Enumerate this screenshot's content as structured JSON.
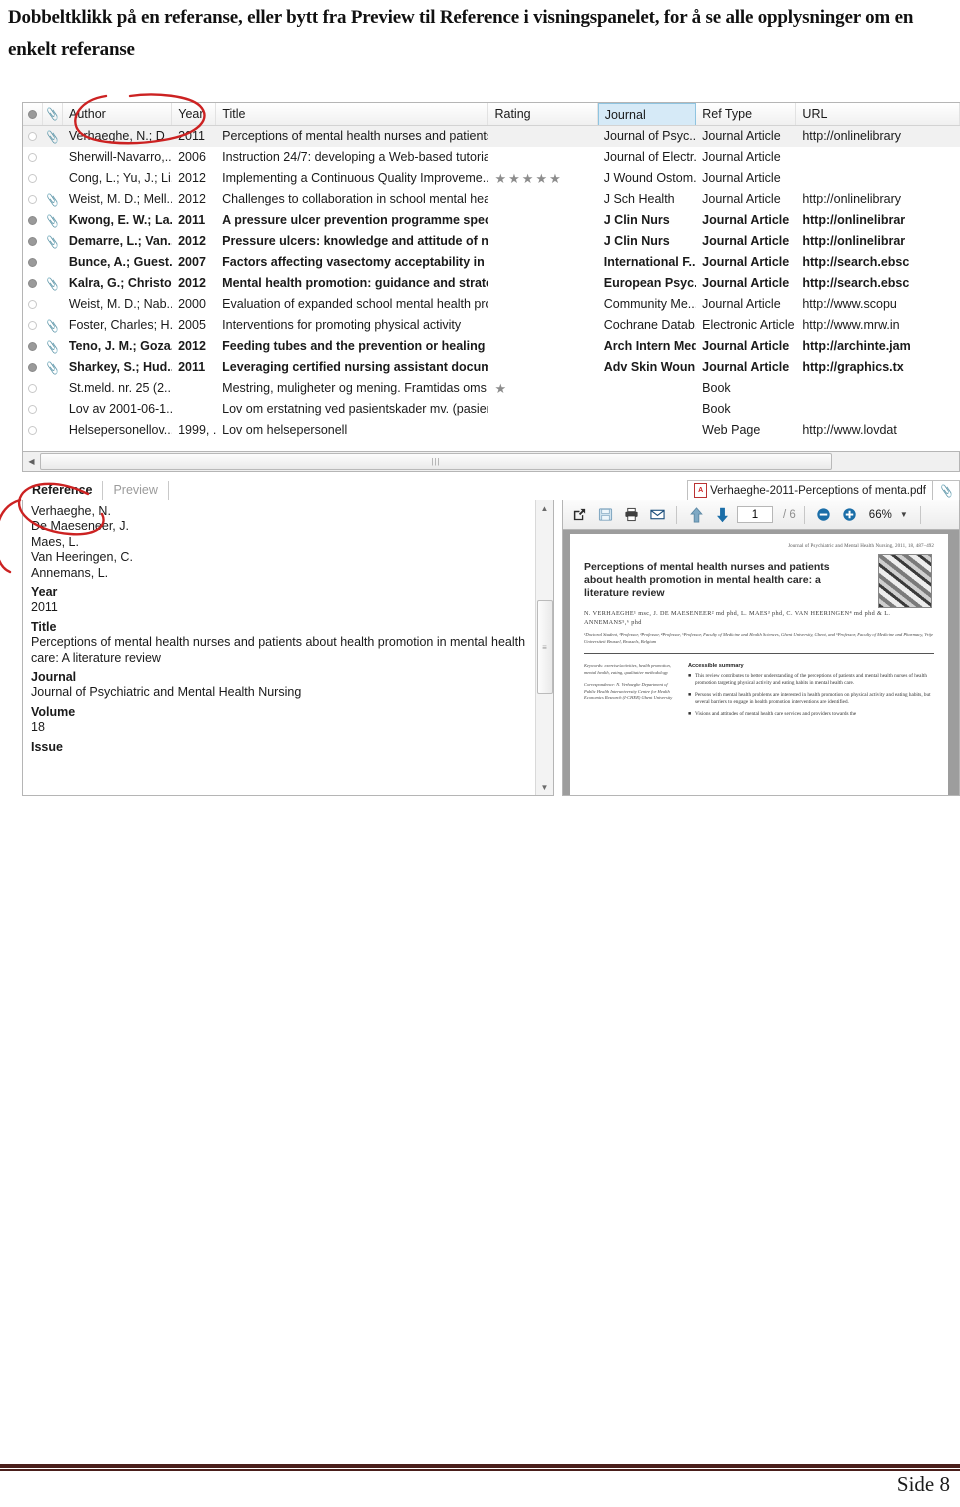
{
  "heading": "Dobbeltklikk på en referanse, eller bytt fra Preview til Reference i visningspanelet, for å se alle opplysninger om en enkelt referanse",
  "list": {
    "columns": [
      "Author",
      "Year",
      "Title",
      "Rating",
      "Journal",
      "Ref Type",
      "URL"
    ],
    "highlighted_column": "Journal",
    "rows": [
      {
        "read": false,
        "clip": true,
        "bold": false,
        "selected": true,
        "author": "Verhaeghe, N.; D...",
        "year": "2011",
        "title": "Perceptions of mental health nurses and patients...",
        "rating": 0,
        "journal": "Journal of Psyc...",
        "reftype": "Journal Article",
        "url": "http://onlinelibrary"
      },
      {
        "read": false,
        "clip": false,
        "bold": false,
        "selected": false,
        "author": "Sherwill-Navarro,...",
        "year": "2006",
        "title": "Instruction 24/7: developing a Web-based tutoria...",
        "rating": 0,
        "journal": "Journal of Electr...",
        "reftype": "Journal Article",
        "url": ""
      },
      {
        "read": false,
        "clip": false,
        "bold": false,
        "selected": false,
        "author": "Cong, L.; Yu, J.; Li...",
        "year": "2012",
        "title": "Implementing a Continuous Quality Improveme...",
        "rating": 5,
        "journal": "J Wound Ostom...",
        "reftype": "Journal Article",
        "url": ""
      },
      {
        "read": false,
        "clip": true,
        "bold": false,
        "selected": false,
        "author": "Weist, M. D.; Mell...",
        "year": "2012",
        "title": "Challenges to collaboration in school mental hea...",
        "rating": 0,
        "journal": "J Sch Health",
        "reftype": "Journal Article",
        "url": "http://onlinelibrary"
      },
      {
        "read": true,
        "clip": true,
        "bold": true,
        "selected": false,
        "author": "Kwong, E. W.; La...",
        "year": "2011",
        "title": "A pressure ulcer prevention programme speci...",
        "rating": 0,
        "journal": "J Clin Nurs",
        "reftype": "Journal Article",
        "url": "http://onlinelibrar"
      },
      {
        "read": true,
        "clip": true,
        "bold": true,
        "selected": false,
        "author": "Demarre, L.; Van...",
        "year": "2012",
        "title": "Pressure ulcers: knowledge and attitude of nu...",
        "rating": 0,
        "journal": "J Clin Nurs",
        "reftype": "Journal Article",
        "url": "http://onlinelibrar"
      },
      {
        "read": true,
        "clip": false,
        "bold": true,
        "selected": false,
        "author": "Bunce, A.; Guest...",
        "year": "2007",
        "title": "Factors affecting vasectomy acceptability in Ta...",
        "rating": 0,
        "journal": "International F...",
        "reftype": "Journal Article",
        "url": "http://search.ebsc"
      },
      {
        "read": true,
        "clip": true,
        "bold": true,
        "selected": false,
        "author": "Kalra, G.; Christo...",
        "year": "2012",
        "title": "Mental health promotion: guidance and strate...",
        "rating": 0,
        "journal": "European Psyc...",
        "reftype": "Journal Article",
        "url": "http://search.ebsc"
      },
      {
        "read": false,
        "clip": false,
        "bold": false,
        "selected": false,
        "author": "Weist, M. D.; Nab...",
        "year": "2000",
        "title": "Evaluation of expanded school mental health pro...",
        "rating": 0,
        "journal": "Community Me...",
        "reftype": "Journal Article",
        "url": "http://www.scopu"
      },
      {
        "read": false,
        "clip": true,
        "bold": false,
        "selected": false,
        "author": "Foster, Charles; H...",
        "year": "2005",
        "title": "Interventions for promoting physical activity",
        "rating": 0,
        "journal": "Cochrane Datab...",
        "reftype": "Electronic Article",
        "url": "http://www.mrw.in"
      },
      {
        "read": true,
        "clip": true,
        "bold": true,
        "selected": false,
        "author": "Teno, J. M.; Goza...",
        "year": "2012",
        "title": "Feeding tubes and the prevention or healing o...",
        "rating": 0,
        "journal": "Arch Intern Med",
        "reftype": "Journal Article",
        "url": "http://archinte.jam"
      },
      {
        "read": true,
        "clip": true,
        "bold": true,
        "selected": false,
        "author": "Sharkey, S.; Hud...",
        "year": "2011",
        "title": "Leveraging certified nursing assistant docume...",
        "rating": 0,
        "journal": "Adv Skin Woun...",
        "reftype": "Journal Article",
        "url": "http://graphics.tx"
      },
      {
        "read": false,
        "clip": false,
        "bold": false,
        "selected": false,
        "author": "St.meld. nr. 25 (2...",
        "year": "",
        "title": "Mestring, muligheter og mening. Framtidas oms...",
        "rating": 1,
        "journal": "",
        "reftype": "Book",
        "url": ""
      },
      {
        "read": false,
        "clip": false,
        "bold": false,
        "selected": false,
        "author": "Lov av 2001-06-1...",
        "year": "",
        "title": "Lov om erstatning ved pasientskader mv. (pasien...",
        "rating": 0,
        "journal": "",
        "reftype": "Book",
        "url": ""
      },
      {
        "read": false,
        "clip": false,
        "bold": false,
        "selected": false,
        "author": "Helsepersonellov...",
        "year": "1999, ...",
        "title": "Lov om helsepersonell",
        "rating": 0,
        "journal": "",
        "reftype": "Web Page",
        "url": "http://www.lovdat"
      }
    ]
  },
  "detail": {
    "tabs": [
      {
        "label": "Reference",
        "active": true
      },
      {
        "label": "Preview",
        "active": false
      }
    ],
    "authors": [
      "Verhaeghe, N.",
      "De Maeseneer, J.",
      "Maes, L.",
      "Van Heeringen, C.",
      "Annemans, L."
    ],
    "fields": [
      {
        "label": "Year",
        "value": "2011"
      },
      {
        "label": "Title",
        "value": "Perceptions of mental health nurses and patients about health promotion in mental health care: A literature review"
      },
      {
        "label": "Journal",
        "value": "Journal of Psychiatric and Mental Health Nursing"
      },
      {
        "label": "Volume",
        "value": "18"
      },
      {
        "label": "Issue",
        "value": ""
      }
    ]
  },
  "pdf": {
    "tab_label": "Verhaeghe-2011-Perceptions of menta.pdf",
    "toolbar": {
      "open_external": "open-external",
      "save": "save",
      "print": "print",
      "email": "email",
      "prev_page": "previous-page",
      "next_page": "next-page",
      "page_current": "1",
      "page_total": "/ 6",
      "zoom_out": "zoom-out",
      "zoom_in": "zoom-in",
      "zoom_value": "66%"
    },
    "page": {
      "journal_ref": "Journal of Psychiatric and Mental Health Nursing, 2011, 18, 487–492",
      "title": "Perceptions of mental health nurses and patients about health promotion in mental health care: a literature review",
      "authors": "N. VERHAEGHE¹ msc, J. DE MAESENEER² md phd, L. MAES³ phd, C. VAN HEERINGEN⁴ md phd & L. ANNEMANS⁵,⁶ phd",
      "affiliations": "¹Doctoral Student, ²Professor, ³Professor, ⁴Professor, ⁵Professor, Faculty of Medicine and Health Sciences, Ghent University, Ghent, and ⁶Professor, Faculty of Medicine and Pharmacy, Vrije Universiteit Brussel, Brussels, Belgium",
      "keywords": "Keywords: exercise/activities, health promotion, mental health, eating, qualitative methodology",
      "correspondence": "Correspondence: N. Verhaeghe Department of Public Health Interuniversity Centre for Health Economics Research (I-CHER) Ghent University",
      "summary_heading": "Accessible summary",
      "summary_bullets": [
        "This review contributes to better understanding of the perceptions of patients and mental health nurses of health promotion targeting physical activity and eating habits in mental health care.",
        "Persons with mental health problems are interested in health promotion on physical activity and eating habits, but several barriers to engage in health promotion interventions are identified.",
        "Visions and attitudes of mental health care services and providers towards the"
      ]
    }
  },
  "footer": {
    "page_label": "Side 8"
  },
  "colors": {
    "accent": "#d6eaf7",
    "ink": "#cc2222",
    "footer_rule": "#4a1f1b"
  }
}
